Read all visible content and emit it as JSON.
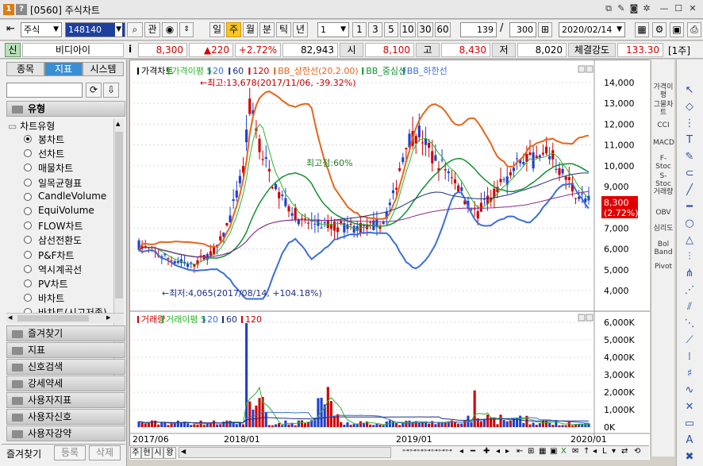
{
  "window": {
    "id": "[0560]",
    "title": "주식차트"
  },
  "toolbar": {
    "market": "주식",
    "code": "148140",
    "btn_lookup": "관",
    "periods": [
      "일",
      "주",
      "월",
      "분",
      "틱",
      "년"
    ],
    "selected_period": "주",
    "unit_select": "1",
    "quick_units": [
      "1",
      "3",
      "5",
      "10",
      "30",
      "60"
    ],
    "count": "139",
    "total": "300",
    "date": "2020/02/14"
  },
  "quote": {
    "badge": "신",
    "name": "비디아이",
    "info": "i",
    "price": "8,300",
    "change": "▲220",
    "change_pct": "+2.72%",
    "volume": "82,943",
    "open_label": "시",
    "open": "8,100",
    "high_label": "고",
    "high": "8,430",
    "low_label": "저",
    "low": "8,020",
    "strength_label": "체결강도",
    "strength": "133.30",
    "period_tag": "[1주]"
  },
  "left_panel": {
    "tabs": [
      "종목",
      "지표",
      "시스템"
    ],
    "active_tab": "지표",
    "section_title": "유형",
    "tree_header": "차트유형",
    "chart_types": [
      "봉차트",
      "선차트",
      "매물차트",
      "일목균형표",
      "CandleVolume",
      "EquiVolume",
      "FLOW차트",
      "삼선전환도",
      "P&F차트",
      "역시계곡선",
      "PV차트",
      "바차트",
      "바차트(시고저종)"
    ],
    "selected_type": "봉차트",
    "folders": [
      "즐겨찾기",
      "지표",
      "신호검색",
      "강세약세",
      "사용자지표",
      "사용자신호",
      "사용자강약"
    ],
    "bottom_tabs": [
      "즐겨찾기",
      "등록",
      "삭제"
    ]
  },
  "price_pane": {
    "legend": [
      "가격차트",
      "가격이평 5",
      "20",
      "60",
      "120",
      "BB_상한선(20,2.00)",
      "BB_중심선",
      "BB_하한선"
    ],
    "max_label": "←최고:13,678(2017/11/06, -39.32%)",
    "min_label": "←최저:4,065(2017/08/14, +104.18%)",
    "mid_label": "최고점:60%",
    "current_price": "8,300",
    "current_pct": "(2.72%)",
    "y_ticks": [
      "14,000",
      "13,000",
      "12,000",
      "11,000",
      "10,000",
      "9,000",
      "8,000",
      "7,000",
      "6,000",
      "5,000",
      "4,000"
    ]
  },
  "volume_pane": {
    "legend": [
      "거래량",
      "거래이평 5",
      "20",
      "60",
      "120"
    ],
    "y_ticks": [
      "6,000K",
      "5,000K",
      "4,000K",
      "3,000K",
      "2,000K",
      "1,000K",
      "0K"
    ]
  },
  "x_axis": {
    "labels": [
      "2017/06",
      "2018/01",
      "2019/01",
      "2020/01"
    ]
  },
  "colors": {
    "up": "#d00000",
    "down": "#1f3fd0",
    "ma5": "#2bb52b",
    "bb_upper": "#e8641c",
    "bb_mid": "#109030",
    "bb_lower": "#3a6fd8",
    "ma60": "#203080",
    "ma120": "#8a2d8a"
  },
  "right_indicators": [
    "가격이평",
    "그물차트",
    "CCI",
    "MACD",
    "F-Stoc",
    "S-Stoc",
    "거래량",
    "OBV",
    "심리도",
    "Bol Band",
    "Pivot"
  ],
  "bottom_bar": {
    "tabs": [
      "주",
      "현",
      "시",
      "왕"
    ]
  }
}
